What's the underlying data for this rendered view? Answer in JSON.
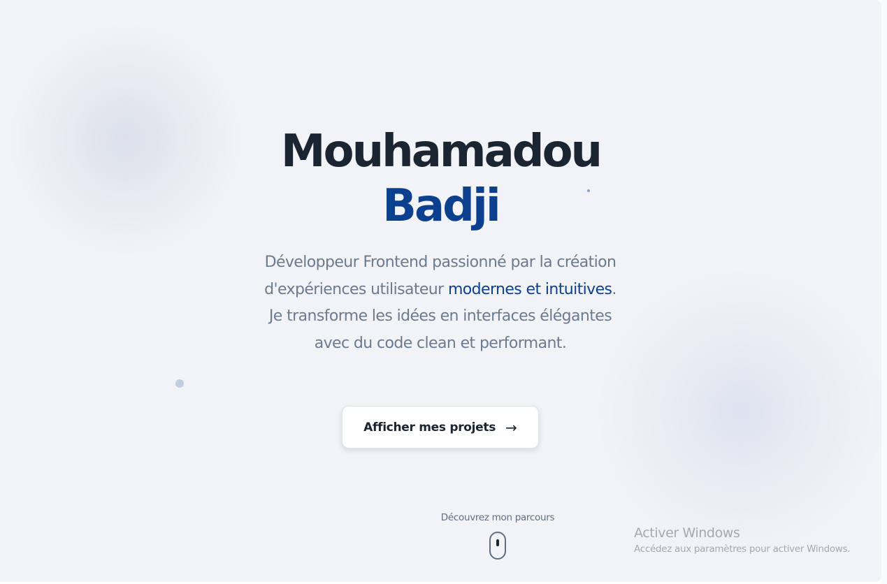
{
  "hero": {
    "first_name": "Mouhamadou",
    "last_name": "Badji",
    "description_before": "Développeur Frontend passionné par la création d'expériences utilisateur ",
    "description_highlight": "modernes et intuitives",
    "description_after": ". Je transforme les idées en interfaces élégantes avec du code clean et performant.",
    "cta_label": "Afficher mes projets",
    "cta_icon": "arrow-right-icon"
  },
  "scroll": {
    "label": "Découvrez mon parcours",
    "icon": "mouse-scroll-icon"
  },
  "windows_watermark": {
    "title": "Activer Windows",
    "subtitle": "Accédez aux paramètres pour activer Windows."
  },
  "colors": {
    "background": "#f1f3f7",
    "heading_dark": "#1b2431",
    "accent_blue": "#0d3f8f",
    "body_text": "#6c7a90"
  }
}
